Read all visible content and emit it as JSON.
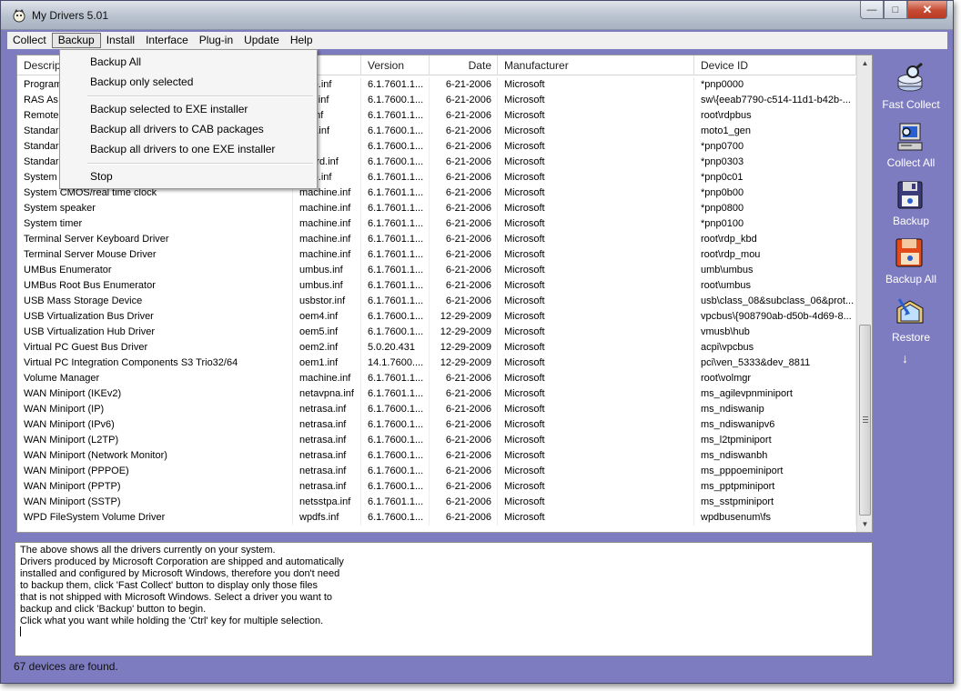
{
  "window": {
    "title": "My Drivers 5.01"
  },
  "menu": {
    "items": [
      "Collect",
      "Backup",
      "Install",
      "Interface",
      "Plug-in",
      "Update",
      "Help"
    ],
    "active": "Backup"
  },
  "backup_menu": {
    "items": [
      "Backup All",
      "Backup only selected",
      "Backup selected to EXE installer",
      "Backup all drivers to CAB packages",
      "Backup all drivers to one EXE installer",
      "Stop"
    ]
  },
  "table": {
    "columns": [
      "Descripti",
      "Version",
      "Date",
      "Manufacturer",
      "Device ID"
    ],
    "rows": [
      [
        "Program",
        "hine.inf",
        "6.1.7601.1...",
        "6-21-2006",
        "Microsoft",
        "*pnp0000"
      ],
      [
        "RAS As",
        "asa.inf",
        "6.1.7600.1...",
        "6-21-2006",
        "Microsoft",
        "sw\\{eeab7790-c514-11d1-b42b-..."
      ],
      [
        "Remote",
        "us.inf",
        "6.1.7601.1...",
        "6-21-2006",
        "Microsoft",
        "root\\rdpbus"
      ],
      [
        "Standar",
        "gen.inf",
        "6.1.7600.1...",
        "6-21-2006",
        "Microsoft",
        "moto1_gen"
      ],
      [
        "Standar",
        "nf",
        "6.1.7600.1...",
        "6-21-2006",
        "Microsoft",
        "*pnp0700"
      ],
      [
        "Standar",
        "board.inf",
        "6.1.7600.1...",
        "6-21-2006",
        "Microsoft",
        "*pnp0303"
      ],
      [
        "System",
        "hine.inf",
        "6.1.7601.1...",
        "6-21-2006",
        "Microsoft",
        "*pnp0c01"
      ],
      [
        "System CMOS/real time clock",
        "machine.inf",
        "6.1.7601.1...",
        "6-21-2006",
        "Microsoft",
        "*pnp0b00"
      ],
      [
        "System speaker",
        "machine.inf",
        "6.1.7601.1...",
        "6-21-2006",
        "Microsoft",
        "*pnp0800"
      ],
      [
        "System timer",
        "machine.inf",
        "6.1.7601.1...",
        "6-21-2006",
        "Microsoft",
        "*pnp0100"
      ],
      [
        "Terminal Server Keyboard Driver",
        "machine.inf",
        "6.1.7601.1...",
        "6-21-2006",
        "Microsoft",
        "root\\rdp_kbd"
      ],
      [
        "Terminal Server Mouse Driver",
        "machine.inf",
        "6.1.7601.1...",
        "6-21-2006",
        "Microsoft",
        "root\\rdp_mou"
      ],
      [
        "UMBus Enumerator",
        "umbus.inf",
        "6.1.7601.1...",
        "6-21-2006",
        "Microsoft",
        "umb\\umbus"
      ],
      [
        "UMBus Root Bus Enumerator",
        "umbus.inf",
        "6.1.7601.1...",
        "6-21-2006",
        "Microsoft",
        "root\\umbus"
      ],
      [
        "USB Mass Storage Device",
        "usbstor.inf",
        "6.1.7601.1...",
        "6-21-2006",
        "Microsoft",
        "usb\\class_08&subclass_06&prot..."
      ],
      [
        "USB Virtualization Bus Driver",
        "oem4.inf",
        "6.1.7600.1...",
        "12-29-2009",
        "Microsoft",
        "vpcbus\\{908790ab-d50b-4d69-8..."
      ],
      [
        "USB Virtualization Hub Driver",
        "oem5.inf",
        "6.1.7600.1...",
        "12-29-2009",
        "Microsoft",
        "vmusb\\hub"
      ],
      [
        "Virtual PC Guest Bus Driver",
        "oem2.inf",
        "5.0.20.431",
        "12-29-2009",
        "Microsoft",
        "acpi\\vpcbus"
      ],
      [
        "Virtual PC Integration Components S3 Trio32/64",
        "oem1.inf",
        "14.1.7600....",
        "12-29-2009",
        "Microsoft",
        "pci\\ven_5333&dev_8811"
      ],
      [
        "Volume Manager",
        "machine.inf",
        "6.1.7601.1...",
        "6-21-2006",
        "Microsoft",
        "root\\volmgr"
      ],
      [
        "WAN Miniport (IKEv2)",
        "netavpna.inf",
        "6.1.7601.1...",
        "6-21-2006",
        "Microsoft",
        "ms_agilevpnminiport"
      ],
      [
        "WAN Miniport (IP)",
        "netrasa.inf",
        "6.1.7600.1...",
        "6-21-2006",
        "Microsoft",
        "ms_ndiswanip"
      ],
      [
        "WAN Miniport (IPv6)",
        "netrasa.inf",
        "6.1.7600.1...",
        "6-21-2006",
        "Microsoft",
        "ms_ndiswanipv6"
      ],
      [
        "WAN Miniport (L2TP)",
        "netrasa.inf",
        "6.1.7600.1...",
        "6-21-2006",
        "Microsoft",
        "ms_l2tpminiport"
      ],
      [
        "WAN Miniport (Network Monitor)",
        "netrasa.inf",
        "6.1.7600.1...",
        "6-21-2006",
        "Microsoft",
        "ms_ndiswanbh"
      ],
      [
        "WAN Miniport (PPPOE)",
        "netrasa.inf",
        "6.1.7600.1...",
        "6-21-2006",
        "Microsoft",
        "ms_pppoeminiport"
      ],
      [
        "WAN Miniport (PPTP)",
        "netrasa.inf",
        "6.1.7600.1...",
        "6-21-2006",
        "Microsoft",
        "ms_pptpminiport"
      ],
      [
        "WAN Miniport (SSTP)",
        "netsstpa.inf",
        "6.1.7601.1...",
        "6-21-2006",
        "Microsoft",
        "ms_sstpminiport"
      ],
      [
        "WPD FileSystem Volume Driver",
        "wpdfs.inf",
        "6.1.7600.1...",
        "6-21-2006",
        "Microsoft",
        "wpdbusenum\\fs"
      ]
    ]
  },
  "info": {
    "lines": [
      "The above shows all the drivers currently on your system.",
      "Drivers produced by Microsoft Corporation are shipped and automatically",
      "installed and configured by Microsoft Windows, therefore you don't need",
      "to backup them, click 'Fast Collect' button to display only those files",
      "that is not shipped with Microsoft Windows. Select a driver you want to",
      "backup and click 'Backup' button to begin.",
      "Click what you want while holding the 'Ctrl' key for multiple selection."
    ]
  },
  "status": {
    "text": "67 devices are found."
  },
  "toolbar": {
    "buttons": [
      {
        "label": "Fast Collect",
        "icon": "magnifier-icon"
      },
      {
        "label": "Collect All",
        "icon": "computer-icon"
      },
      {
        "label": "Backup",
        "icon": "floppy-icon"
      },
      {
        "label": "Backup All",
        "icon": "floppy-stack-icon"
      },
      {
        "label": "Restore",
        "icon": "restore-icon"
      }
    ],
    "more": "↓"
  },
  "colors": {
    "frame": "#7e7cc0",
    "menu_bg": "#f0f0f0"
  }
}
